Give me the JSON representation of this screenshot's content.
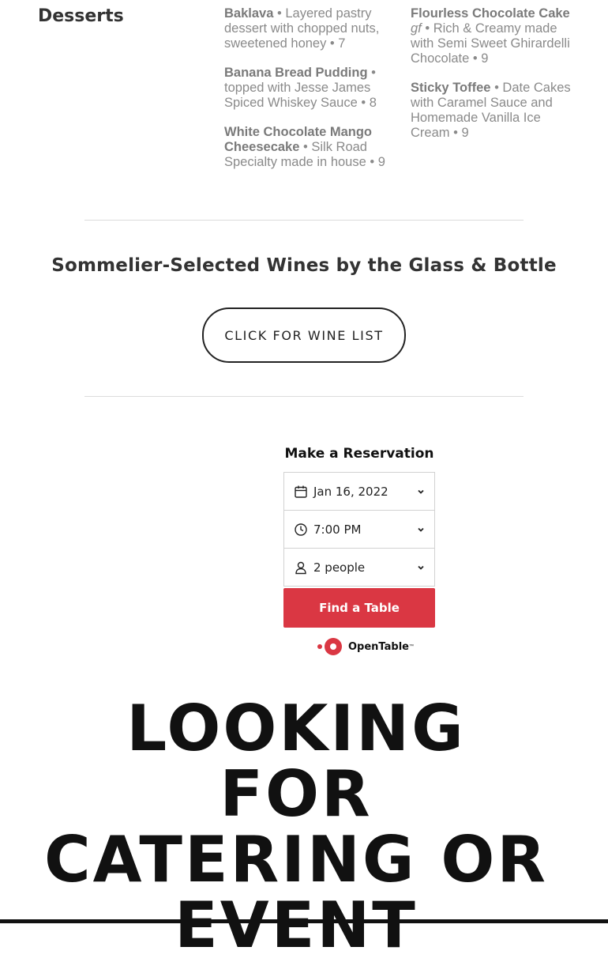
{
  "desserts": {
    "heading": "Desserts",
    "column1": [
      {
        "name": "Baklava",
        "desc": " • Layered pastry dessert with chopped nuts, sweetened honey • 7"
      },
      {
        "name": "Banana Bread Pudding",
        "desc": " • topped with Jesse James Spiced Whiskey Sauce • 8"
      },
      {
        "name": "White Chocolate Mango Cheesecake",
        "desc": " • Silk Road Specialty made in house • 9"
      }
    ],
    "column2": [
      {
        "name": "Flourless Chocolate Cake",
        "tag": "gf",
        "desc": " • Rich & Creamy made with Semi Sweet Ghirardelli Chocolate • 9"
      },
      {
        "name": "Sticky Toffee",
        "desc": " • Date Cakes with Caramel Sauce and Homemade Vanilla Ice Cream • 9"
      }
    ]
  },
  "wines": {
    "title": "Sommelier-Selected Wines by the Glass & Bottle",
    "button_label": "CLICK FOR WINE LIST"
  },
  "reservation": {
    "title": "Make a Reservation",
    "date": "Jan 16, 2022",
    "time": "7:00 PM",
    "party": "2 people",
    "find_label": "Find a Table",
    "brand": "OpenTable",
    "brand_color": "#da3743",
    "icons": {
      "date": "calendar-icon",
      "time": "clock-icon",
      "party": "person-icon",
      "dropdown": "chevron-down-icon"
    }
  },
  "catering": {
    "line1": "LOOKING",
    "line2": "FOR",
    "line3": "CATERING OR",
    "line4": "EVENT"
  }
}
